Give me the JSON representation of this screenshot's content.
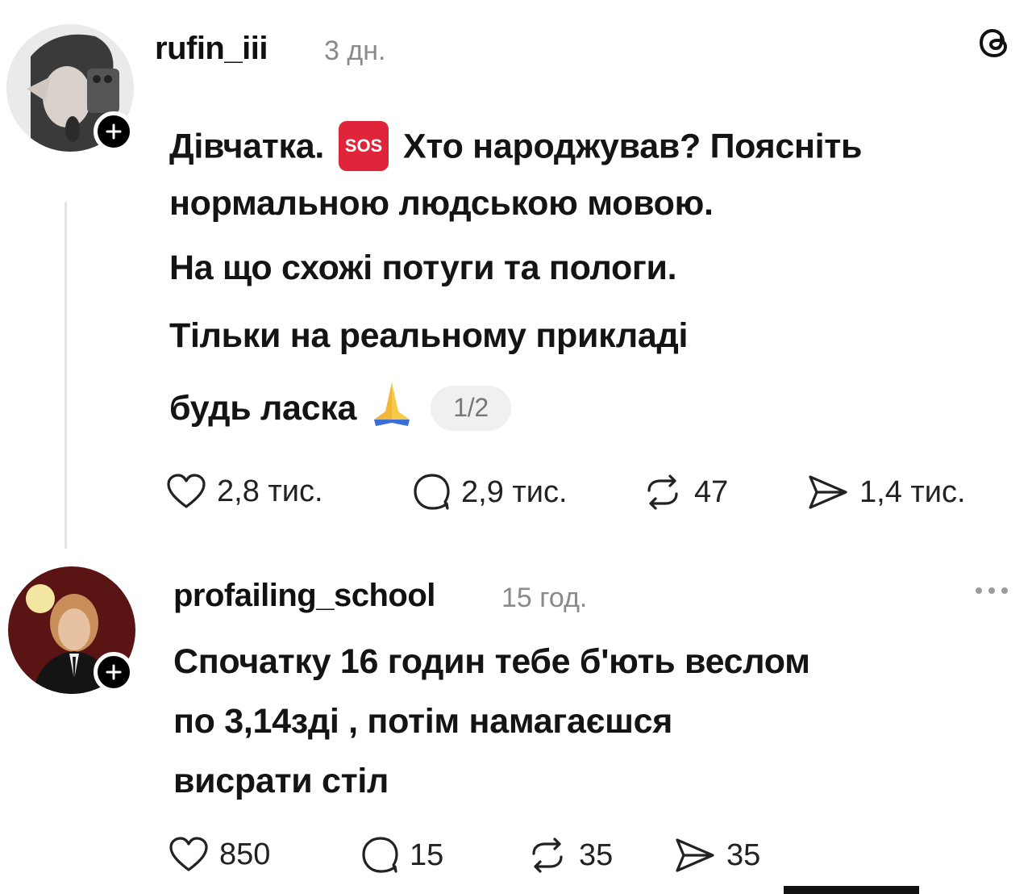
{
  "post": {
    "username": "rufin_iii",
    "time": "3 дн.",
    "lines": [
      "Дівчатка.",
      "Хто народжував? Поясніть",
      "нормальною людською мовою.",
      "На що схожі потуги та пологи.",
      "Тільки на реальному прикладі",
      "будь ласка"
    ],
    "sos_label": "SOS",
    "page_indicator": "1/2",
    "likes": "2,8 тис.",
    "replies": "2,9 тис.",
    "reposts": "47",
    "shares": "1,4 тис."
  },
  "reply": {
    "username": "profailing_school",
    "time": "15 год.",
    "lines": [
      "Спочатку 16 годин тебе б'ють веслом",
      "по 3,14зді , потім намагаєшся",
      "висрати стіл"
    ],
    "likes": "850",
    "replies": "15",
    "reposts": "35",
    "shares": "35"
  },
  "icons": {
    "app_logo": "threads-logo-icon",
    "like": "heart-icon",
    "reply": "comment-icon",
    "repost": "repost-icon",
    "share": "share-icon",
    "follow": "plus-icon",
    "more": "more-dots-icon"
  },
  "colors": {
    "sos": "#e0243a",
    "muted": "#8a8a8a",
    "text": "#141414"
  }
}
